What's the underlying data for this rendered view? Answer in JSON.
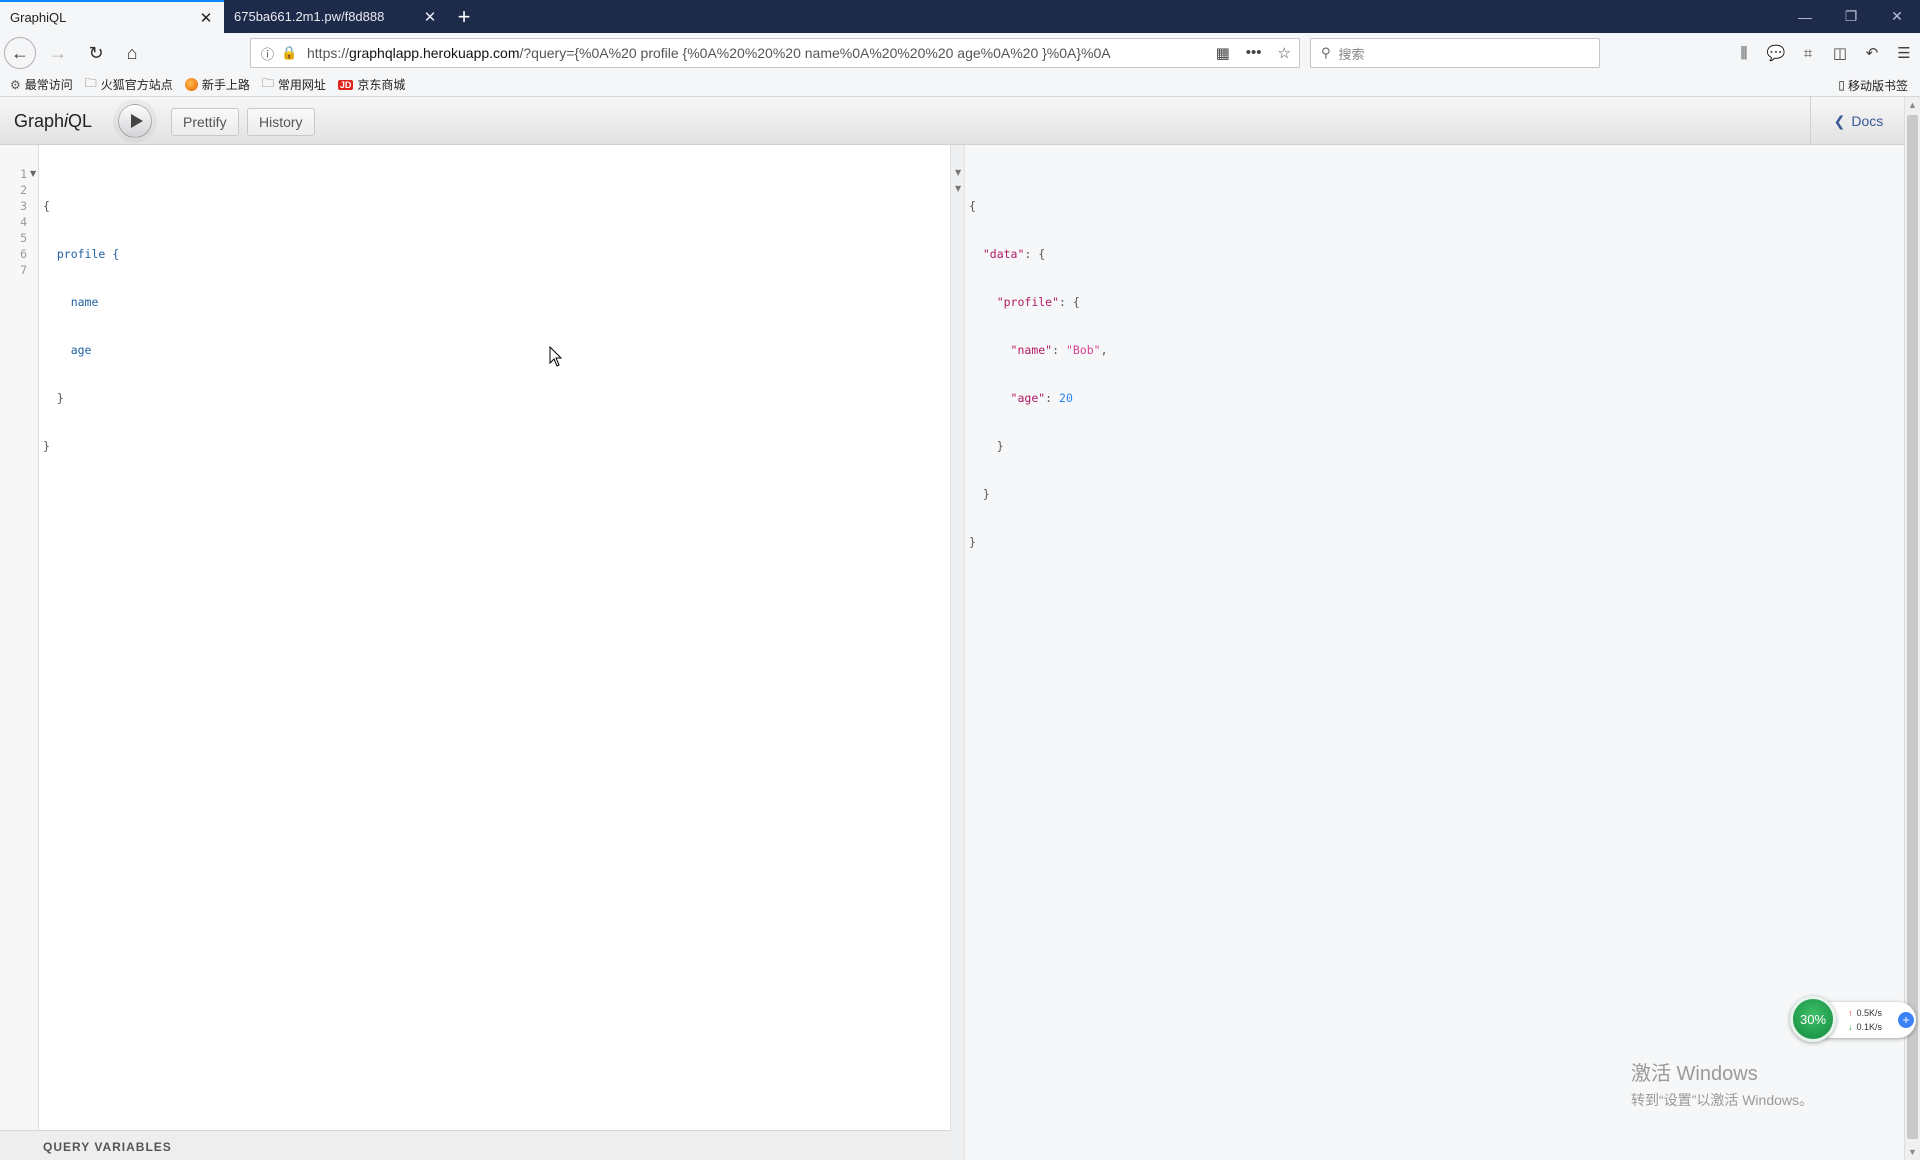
{
  "tabs": [
    {
      "label": "GraphiQL",
      "active": true
    },
    {
      "label": "675ba661.2m1.pw/f8d888",
      "active": false
    }
  ],
  "window_controls": {
    "minimize": "—",
    "restore": "❐",
    "close": "✕"
  },
  "nav": {
    "url_prefix": "https://",
    "url_host": "graphqlapp.herokuapp.com",
    "url_rest": "/?query={%0A%20 profile {%0A%20%20%20 name%0A%20%20%20 age%0A%20 }%0A}%0A",
    "search_placeholder": "搜索"
  },
  "bookmarks": [
    {
      "label": "最常访问",
      "icon": "gear-icon"
    },
    {
      "label": "火狐官方站点",
      "icon": "folder-icon"
    },
    {
      "label": "新手上路",
      "icon": "firefox-icon"
    },
    {
      "label": "常用网址",
      "icon": "folder-icon"
    },
    {
      "label": "京东商城",
      "icon": "jd-icon"
    }
  ],
  "bookmarks_mobile": "移动版书签",
  "graphiql": {
    "title_pre": "Graph",
    "title_i": "i",
    "title_post": "QL",
    "prettify_label": "Prettify",
    "history_label": "History",
    "docs_label": "Docs",
    "query_variables_label": "QUERY VARIABLES"
  },
  "query": {
    "line_numbers": [
      "1",
      "2",
      "3",
      "4",
      "5",
      "6",
      "7"
    ],
    "lines": [
      "{",
      "  profile {",
      "    name",
      "    age",
      "  }",
      "}",
      ""
    ]
  },
  "result": {
    "lines": [
      "{",
      "  \"data\": {",
      "    \"profile\": {",
      "      \"name\": \"Bob\",",
      "      \"age\": 20",
      "    }",
      "  }",
      "}"
    ],
    "name_value": "Bob",
    "age_value": 20
  },
  "net_widget": {
    "percent": "30%",
    "up": "0.5K/s",
    "down": "0.1K/s"
  },
  "watermark": {
    "title": "激活 Windows",
    "subtitle": "转到“设置”以激活 Windows。"
  },
  "colors": {
    "tab_strip": "#1e2a4a",
    "accent": "#0a84ff",
    "docs_link": "#3b5998",
    "json_key": "#b11a65",
    "json_string": "#d64292",
    "json_number": "#2882f9"
  }
}
